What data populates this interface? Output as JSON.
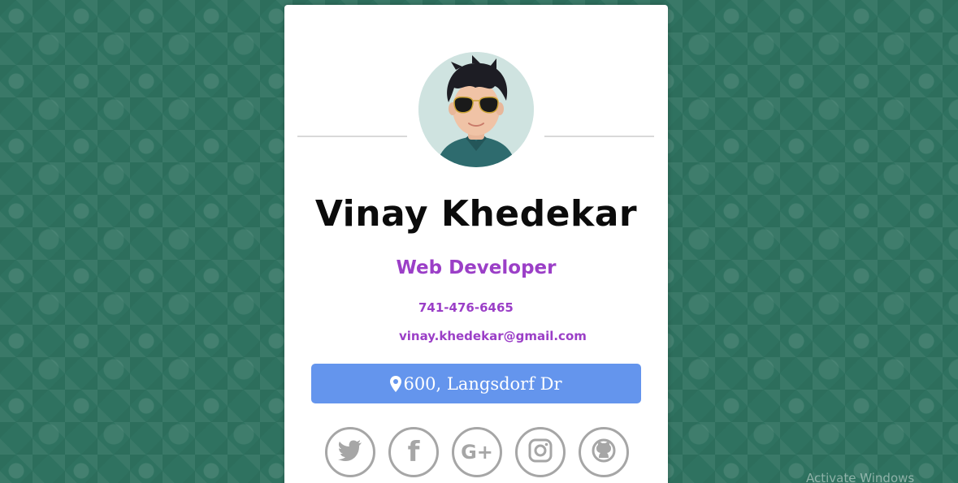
{
  "profile": {
    "name": "Vinay Khedekar",
    "title": "Web Developer",
    "phone": "741-476-6465",
    "email": "vinay.khedekar@gmail.com",
    "address": "600, Langsdorf Dr"
  },
  "socials": [
    {
      "icon": "twitter-icon"
    },
    {
      "icon": "facebook-icon",
      "glyph": "f"
    },
    {
      "icon": "google-plus-icon",
      "glyph": "G+"
    },
    {
      "icon": "instagram-icon"
    },
    {
      "icon": "github-icon"
    }
  ],
  "watermark": "Activate Windows",
  "colors": {
    "background": "#2f7260",
    "accent_purple": "#9b3fc7",
    "address_button": "#6495ed",
    "social_gray": "#a6a6a6"
  }
}
